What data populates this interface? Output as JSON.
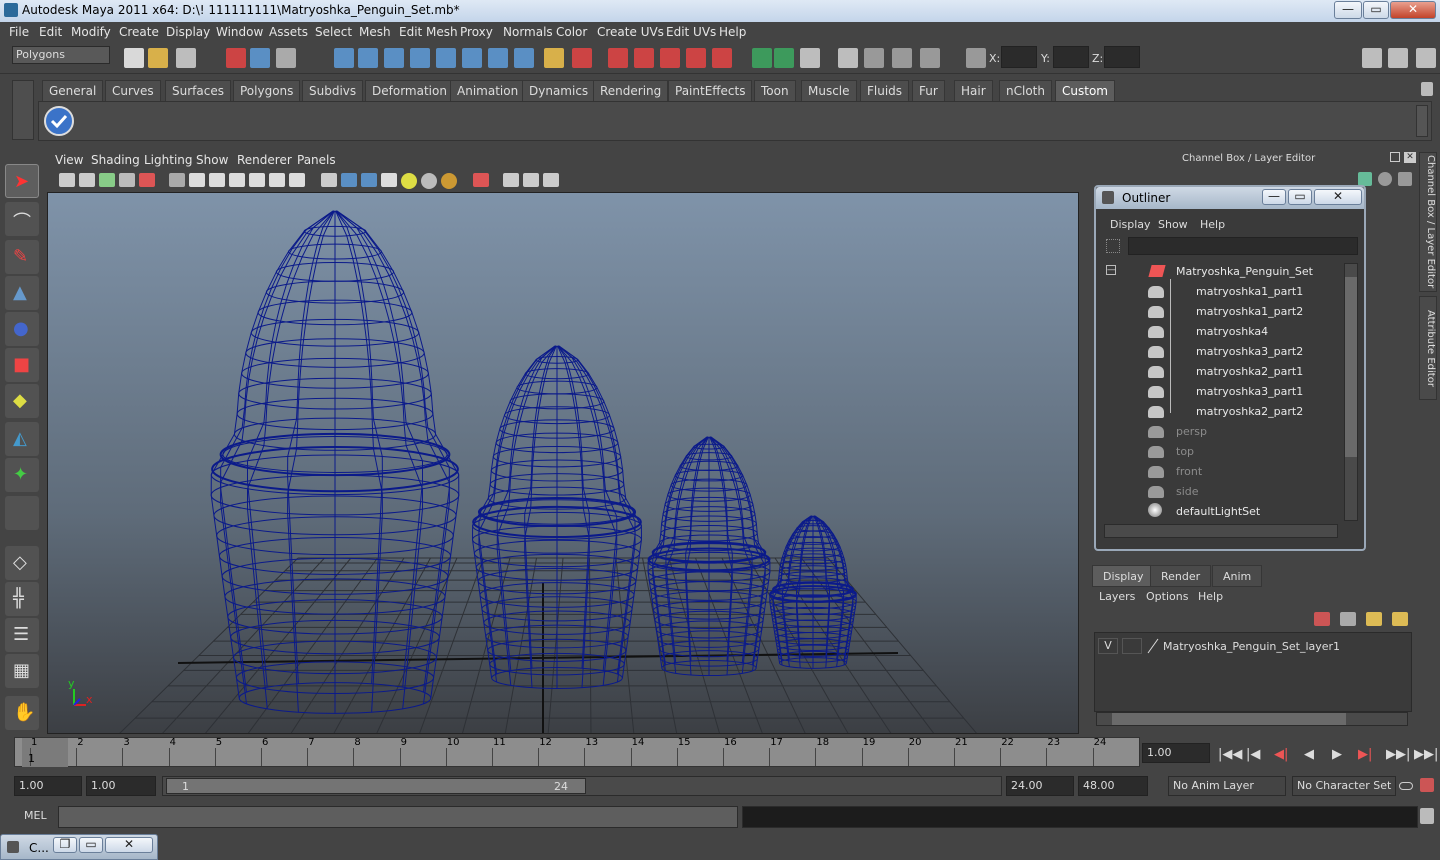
{
  "window": {
    "title": "Autodesk Maya 2011 x64: D:\\! 111111111\\Matryoshka_Penguin_Set.mb*",
    "controls": [
      "—",
      "▭",
      "✕"
    ]
  },
  "menubar": [
    "File",
    "Edit",
    "Modify",
    "Create",
    "Display",
    "Window",
    "Assets",
    "Select",
    "Mesh",
    "Edit Mesh",
    "Proxy",
    "Normals",
    "Color",
    "Create UVs",
    "Edit UVs",
    "Help"
  ],
  "statusline": {
    "mode": "Polygons",
    "x_label": "X:",
    "y_label": "Y:",
    "z_label": "Z:"
  },
  "shelf": {
    "tabs": [
      "General",
      "Curves",
      "Surfaces",
      "Polygons",
      "Subdivs",
      "Deformation",
      "Animation",
      "Dynamics",
      "Rendering",
      "PaintEffects",
      "Toon",
      "Muscle",
      "Fluids",
      "Fur",
      "Hair",
      "nCloth",
      "Custom"
    ],
    "active_tab": "Custom"
  },
  "viewport": {
    "menu": [
      "View",
      "Shading",
      "Lighting",
      "Show",
      "Renderer",
      "Panels"
    ],
    "axis_y": "y",
    "axis_x": "x",
    "wire_color": "#0b1a8a",
    "bg_top": "#7f93a9",
    "bg_bottom": "#3c3f44"
  },
  "channelbox": {
    "header": "Channel Box / Layer Editor"
  },
  "outliner": {
    "title": "Outliner",
    "menu": [
      "Display",
      "Show",
      "Help"
    ],
    "items": [
      {
        "label": "Matryoshka_Penguin_Set",
        "dim": false,
        "collapse": "—"
      },
      {
        "label": "matryoshka1_part1",
        "dim": false
      },
      {
        "label": "matryoshka1_part2",
        "dim": false
      },
      {
        "label": "matryoshka4",
        "dim": false
      },
      {
        "label": "matryoshka3_part2",
        "dim": false
      },
      {
        "label": "matryoshka2_part1",
        "dim": false
      },
      {
        "label": "matryoshka3_part1",
        "dim": false
      },
      {
        "label": "matryoshka2_part2",
        "dim": false
      },
      {
        "label": "persp",
        "dim": true
      },
      {
        "label": "top",
        "dim": true
      },
      {
        "label": "front",
        "dim": true
      },
      {
        "label": "side",
        "dim": true
      },
      {
        "label": "defaultLightSet",
        "dim": false
      }
    ]
  },
  "layer_editor": {
    "tabs": [
      "Display",
      "Render",
      "Anim"
    ],
    "active_tab": "Display",
    "menu": [
      "Layers",
      "Options",
      "Help"
    ],
    "layer_visibility": "V",
    "layer_name": "Matryoshka_Penguin_Set_layer1"
  },
  "side_tabs": [
    "Channel Box / Layer Editor",
    "Attribute Editor"
  ],
  "timeline": {
    "ticks": [
      "1",
      "2",
      "3",
      "4",
      "5",
      "6",
      "7",
      "8",
      "9",
      "10",
      "11",
      "12",
      "13",
      "14",
      "15",
      "16",
      "17",
      "18",
      "19",
      "20",
      "21",
      "22",
      "23",
      "24"
    ],
    "current_frame_marker": "1",
    "current_frame": "1.00",
    "playback_buttons": [
      "|◀◀",
      "|◀",
      "◀|",
      "◀",
      "▶",
      "▶|",
      "▶▶|",
      "▶▶|"
    ]
  },
  "range": {
    "start": "1.00",
    "playback_start": "1.00",
    "slider_start": "1",
    "slider_end": "24",
    "playback_end": "24.00",
    "end": "48.00",
    "anim_layer": "No Anim Layer",
    "character_set": "No Character Set"
  },
  "commandline": {
    "label": "MEL",
    "value": "",
    "result": ""
  },
  "miniwin": {
    "label": "C..."
  }
}
